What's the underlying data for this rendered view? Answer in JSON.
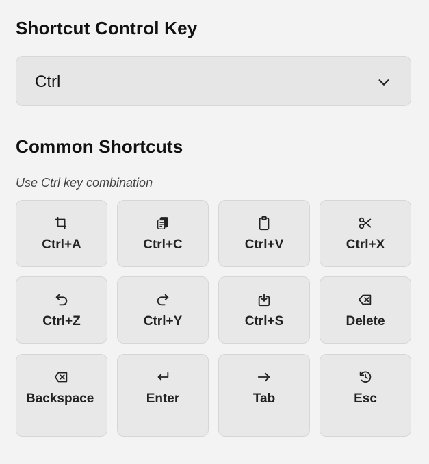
{
  "control_key": {
    "title": "Shortcut Control Key",
    "selected": "Ctrl"
  },
  "shortcuts": {
    "title": "Common Shortcuts",
    "hint": "Use Ctrl key combination",
    "keys": [
      {
        "label": "Ctrl+A",
        "icon": "select-all-icon"
      },
      {
        "label": "Ctrl+C",
        "icon": "copy-icon"
      },
      {
        "label": "Ctrl+V",
        "icon": "paste-icon"
      },
      {
        "label": "Ctrl+X",
        "icon": "cut-icon"
      },
      {
        "label": "Ctrl+Z",
        "icon": "undo-icon"
      },
      {
        "label": "Ctrl+Y",
        "icon": "redo-icon"
      },
      {
        "label": "Ctrl+S",
        "icon": "save-icon"
      },
      {
        "label": "Delete",
        "icon": "delete-icon"
      },
      {
        "label": "Backspace",
        "icon": "backspace-icon"
      },
      {
        "label": "Enter",
        "icon": "enter-icon"
      },
      {
        "label": "Tab",
        "icon": "tab-arrow-icon"
      },
      {
        "label": "Esc",
        "icon": "escape-icon"
      }
    ]
  }
}
